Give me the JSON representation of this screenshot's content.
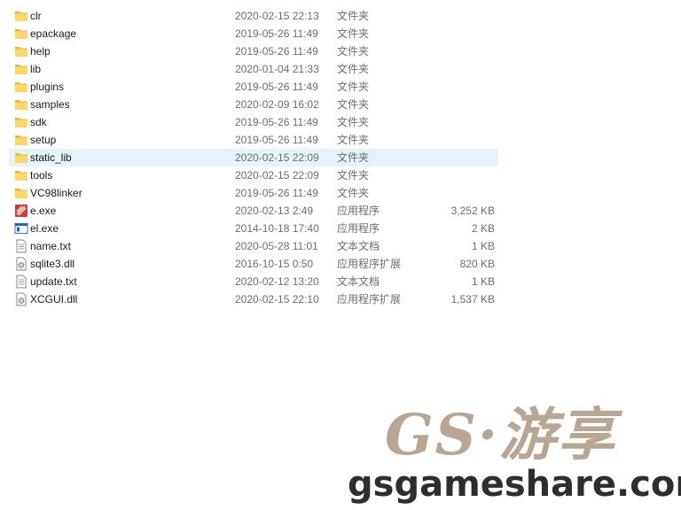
{
  "files": [
    {
      "name": "clr",
      "date": "2020-02-15 22:13",
      "type": "文件夹",
      "size": "",
      "icon": "folder-icon"
    },
    {
      "name": "epackage",
      "date": "2019-05-26 11:49",
      "type": "文件夹",
      "size": "",
      "icon": "folder-icon"
    },
    {
      "name": "help",
      "date": "2019-05-26 11:49",
      "type": "文件夹",
      "size": "",
      "icon": "folder-icon"
    },
    {
      "name": "lib",
      "date": "2020-01-04 21:33",
      "type": "文件夹",
      "size": "",
      "icon": "folder-icon"
    },
    {
      "name": "plugins",
      "date": "2019-05-26 11:49",
      "type": "文件夹",
      "size": "",
      "icon": "folder-icon"
    },
    {
      "name": "samples",
      "date": "2020-02-09 16:02",
      "type": "文件夹",
      "size": "",
      "icon": "folder-icon"
    },
    {
      "name": "sdk",
      "date": "2019-05-26 11:49",
      "type": "文件夹",
      "size": "",
      "icon": "folder-icon"
    },
    {
      "name": "setup",
      "date": "2019-05-26 11:49",
      "type": "文件夹",
      "size": "",
      "icon": "folder-icon"
    },
    {
      "name": "static_lib",
      "date": "2020-02-15 22:09",
      "type": "文件夹",
      "size": "",
      "icon": "folder-icon",
      "selected": true
    },
    {
      "name": "tools",
      "date": "2020-02-15 22:09",
      "type": "文件夹",
      "size": "",
      "icon": "folder-icon"
    },
    {
      "name": "VC98linker",
      "date": "2019-05-26 11:49",
      "type": "文件夹",
      "size": "",
      "icon": "folder-icon"
    },
    {
      "name": "e.exe",
      "date": "2020-02-13 2:49",
      "type": "应用程序",
      "size": "3,252 KB",
      "icon": "e-app-icon"
    },
    {
      "name": "el.exe",
      "date": "2014-10-18 17:40",
      "type": "应用程序",
      "size": "2 KB",
      "icon": "window-app-icon"
    },
    {
      "name": "name.txt",
      "date": "2020-05-28 11:01",
      "type": "文本文档",
      "size": "1 KB",
      "icon": "text-file-icon"
    },
    {
      "name": "sqlite3.dll",
      "date": "2016-10-15 0:50",
      "type": "应用程序扩展",
      "size": "820 KB",
      "icon": "dll-file-icon"
    },
    {
      "name": "update.txt",
      "date": "2020-02-12 13:20",
      "type": "文本文档",
      "size": "1 KB",
      "icon": "text-file-icon"
    },
    {
      "name": "XCGUI.dll",
      "date": "2020-02-15 22:10",
      "type": "应用程序扩展",
      "size": "1,537 KB",
      "icon": "dll-file-icon"
    }
  ],
  "watermark": {
    "top": "GS·游享",
    "bottom": "gsgameshare.com"
  },
  "colors": {
    "folder": "#ffd766",
    "folder_dark": "#e8b73d",
    "selection": "#e5f3fb",
    "meta_text": "#6d6d6d",
    "e_app_red": "#d8382f",
    "window_blue": "#1e64c8"
  }
}
